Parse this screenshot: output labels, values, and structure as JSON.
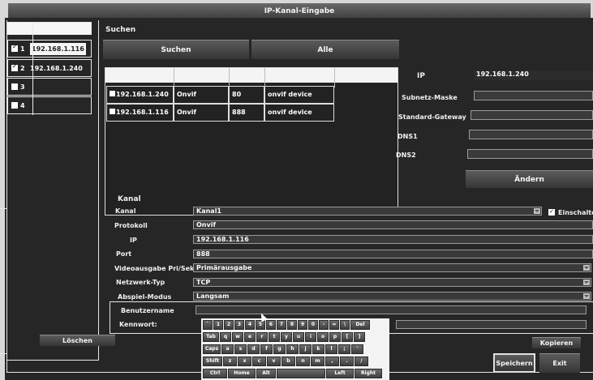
{
  "window": {
    "title": "IP-Kanal-Eingabe"
  },
  "channels": [
    {
      "num": "1",
      "ip": "192.168.1.116",
      "state": "checked"
    },
    {
      "num": "2",
      "ip": "192.168.1.240",
      "state": "checked"
    },
    {
      "num": "3",
      "ip": "",
      "state": "filled"
    },
    {
      "num": "4",
      "ip": "",
      "state": "filled"
    }
  ],
  "search": {
    "heading": "Suchen",
    "search_button": "Suchen",
    "all_button": "Alle",
    "results": [
      {
        "ip": "192.168.1.240",
        "protocol": "Onvif",
        "port": "80",
        "name": "onvif device"
      },
      {
        "ip": "192.168.1.116",
        "protocol": "Onvif",
        "port": "888",
        "name": "onvif device"
      }
    ]
  },
  "network": {
    "ip_label": "IP",
    "ip_value": "192.168.1.240",
    "subnet_label": "Subnetz-Maske",
    "gateway_label": "Standard-Gateway",
    "dns1_label": "DNS1",
    "dns2_label": "DNS2",
    "change_button": "Ändern"
  },
  "channel_form": {
    "section": "Kanal",
    "kanal_label": "Kanal",
    "kanal_value": "Kanal1",
    "enable_label": "Einschalte",
    "protokoll_label": "Protokoll",
    "protokoll_value": "Onvif",
    "ip_label": "IP",
    "ip_value": "192.168.1.116",
    "port_label": "Port",
    "port_value": "888",
    "video_label": "Videoausgabe Pri/Sek",
    "video_value": "Primärausgabe",
    "nettyp_label": "Netzwerk-Typ",
    "nettyp_value": "TCP",
    "playback_label": "Abspiel-Modus",
    "playback_value": "Langsam",
    "user_label": "Benutzername",
    "user_value": "",
    "pass_label": "Kennwort:",
    "pass_value": ""
  },
  "buttons": {
    "delete": "Löschen",
    "copy": "Kopieren",
    "save": "Speichern",
    "exit": "Exit"
  },
  "keyboard": {
    "row1": [
      "`",
      "1",
      "2",
      "3",
      "4",
      "5",
      "6",
      "7",
      "8",
      "9",
      "0",
      "-",
      "=",
      "\\",
      "Del"
    ],
    "row2": [
      "Tab",
      "q",
      "w",
      "e",
      "r",
      "t",
      "y",
      "u",
      "i",
      "o",
      "p",
      "[",
      "]"
    ],
    "row3": [
      "Caps",
      "a",
      "s",
      "d",
      "f",
      "g",
      "h",
      "j",
      "k",
      "l",
      ";",
      "'"
    ],
    "row4": [
      "Shift",
      "z",
      "x",
      "c",
      "v",
      "b",
      "n",
      "m",
      ",",
      ".",
      "/"
    ],
    "row5": [
      "Ctrl",
      "Home",
      "Alt",
      "",
      "Left",
      "Right"
    ]
  }
}
